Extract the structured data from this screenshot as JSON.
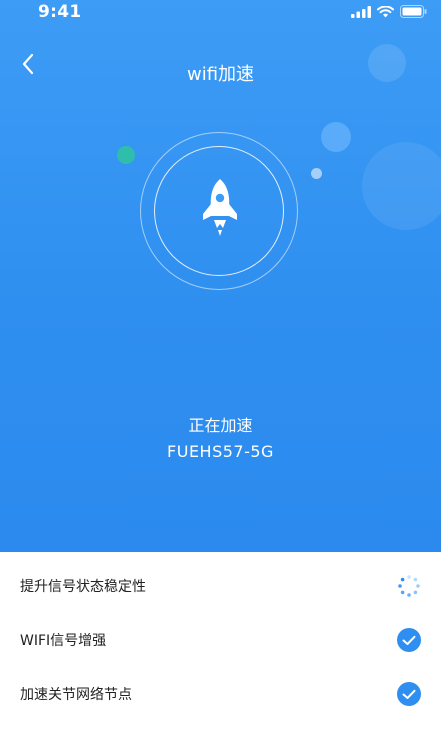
{
  "status_bar": {
    "time": "9:41"
  },
  "header": {
    "title": "wifi加速"
  },
  "accelerate": {
    "status": "正在加速",
    "network_name": "FUEHS57-5G"
  },
  "tasks": [
    {
      "label": "提升信号状态稳定性",
      "state": "loading"
    },
    {
      "label": "WIFI信号增强",
      "state": "done"
    },
    {
      "label": "加速关节网络节点",
      "state": "done"
    }
  ],
  "colors": {
    "primary": "#2f8ff0",
    "accent_dot": "#2ec4a0"
  },
  "icons": [
    "back-arrow-icon",
    "rocket-icon",
    "loading-spinner-icon",
    "check-icon",
    "signal-icon",
    "wifi-icon",
    "battery-icon"
  ]
}
